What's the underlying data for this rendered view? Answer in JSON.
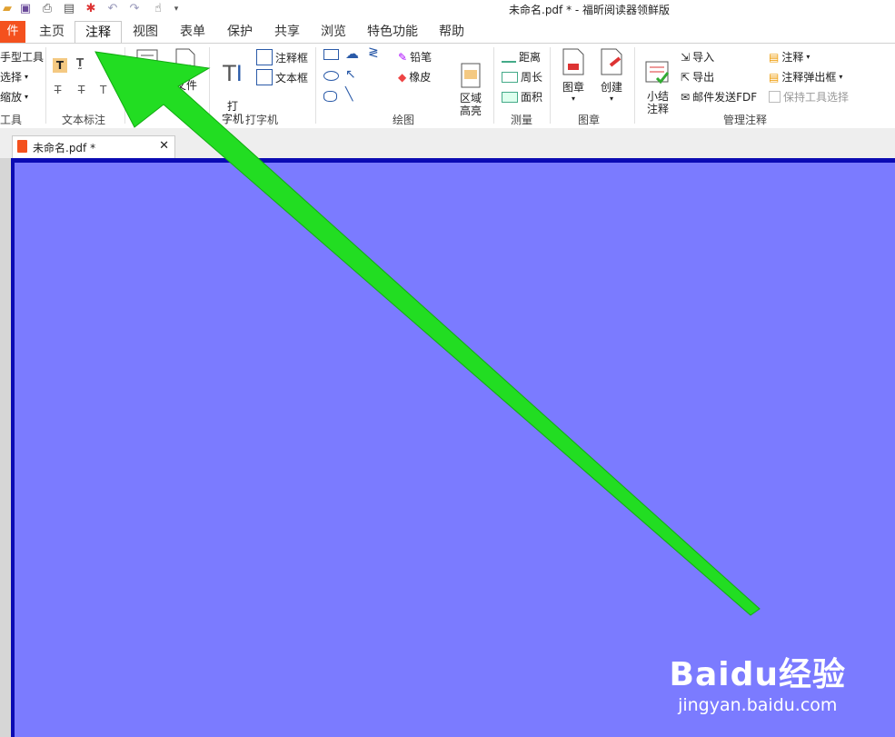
{
  "window_title": "未命名.pdf * - 福昕阅读器领鲜版",
  "quick_access": [
    "folder-icon",
    "save-icon",
    "print-icon",
    "scan-icon",
    "new-icon",
    "undo-icon",
    "redo-icon",
    "hand-icon",
    "more-icon"
  ],
  "file_tab": "件",
  "tabs": [
    "主页",
    "注释",
    "视图",
    "表单",
    "保护",
    "共享",
    "浏览",
    "特色功能",
    "帮助"
  ],
  "active_tab": "注释",
  "ribbon": {
    "tools_items": [
      "手型工具",
      "选择",
      "缩放"
    ],
    "tools_label": "工具",
    "text_markup_label": "文本标注",
    "file_btn": "文件",
    "typewriter_btn": "打\n字机",
    "callout": "注释框",
    "textbox": "文本框",
    "typewriter_label": "打字机",
    "pencil": "铅笔",
    "eraser": "橡皮",
    "area_highlight": "区域\n高亮",
    "drawing_label": "绘图",
    "distance": "距离",
    "perimeter": "周长",
    "area": "面积",
    "measure_label": "测量",
    "stamp": "图章",
    "create": "创建",
    "stamp_label": "图章",
    "summary": "小结\n注释",
    "import": "导入",
    "export": "导出",
    "email_fdf": "邮件发送FDF",
    "comment": "注释",
    "comment_popup": "注释弹出框",
    "keep_tool": "保持工具选择",
    "manage_label": "管理注释"
  },
  "doc_tab": "未命名.pdf *",
  "watermark": {
    "brand": "Baidu经验",
    "url": "jingyan.baidu.com"
  },
  "colors": {
    "file_tab": "#f4511e",
    "page": "#7b7bff",
    "page_border": "#0b0bb3",
    "arrow": "#22dd22"
  }
}
